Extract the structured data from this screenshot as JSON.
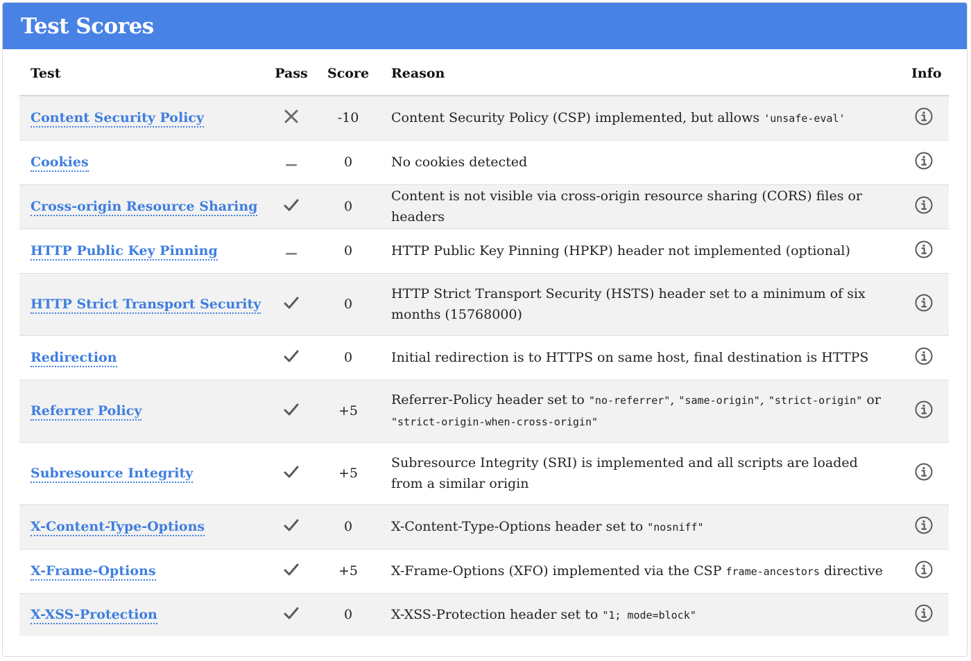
{
  "header": {
    "title": "Test Scores"
  },
  "columns": {
    "test": "Test",
    "pass": "Pass",
    "score": "Score",
    "reason": "Reason",
    "info": "Info"
  },
  "rows": [
    {
      "test": "Content Security Policy",
      "pass": "fail",
      "score": "-10",
      "reason": [
        {
          "t": "Content Security Policy (CSP) implemented, but allows "
        },
        {
          "t": "'unsafe-eval'",
          "code": true
        }
      ]
    },
    {
      "test": "Cookies",
      "pass": "neutral",
      "score": "0",
      "reason": [
        {
          "t": "No cookies detected"
        }
      ]
    },
    {
      "test": "Cross-origin Resource Sharing",
      "pass": "pass",
      "score": "0",
      "reason": [
        {
          "t": "Content is not visible via cross-origin resource sharing (CORS) files or headers"
        }
      ]
    },
    {
      "test": "HTTP Public Key Pinning",
      "pass": "neutral",
      "score": "0",
      "reason": [
        {
          "t": "HTTP Public Key Pinning (HPKP) header not implemented (optional)"
        }
      ]
    },
    {
      "test": "HTTP Strict Transport Security",
      "pass": "pass",
      "score": "0",
      "reason": [
        {
          "t": "HTTP Strict Transport Security (HSTS) header set to a minimum of six months (15768000)"
        }
      ]
    },
    {
      "test": "Redirection",
      "pass": "pass",
      "score": "0",
      "reason": [
        {
          "t": "Initial redirection is to HTTPS on same host, final destination is HTTPS"
        }
      ]
    },
    {
      "test": "Referrer Policy",
      "pass": "pass",
      "score": "+5",
      "reason": [
        {
          "t": "Referrer-Policy header set to "
        },
        {
          "t": "\"no-referrer\"",
          "code": true
        },
        {
          "t": ", "
        },
        {
          "t": "\"same-origin\"",
          "code": true
        },
        {
          "t": ", "
        },
        {
          "t": "\"strict-origin\"",
          "code": true
        },
        {
          "t": " or "
        },
        {
          "t": "\"strict-origin-when-cross-origin\"",
          "code": true
        }
      ]
    },
    {
      "test": "Subresource Integrity",
      "pass": "pass",
      "score": "+5",
      "reason": [
        {
          "t": "Subresource Integrity (SRI) is implemented and all scripts are loaded from a similar origin"
        }
      ]
    },
    {
      "test": "X-Content-Type-Options",
      "pass": "pass",
      "score": "0",
      "reason": [
        {
          "t": "X-Content-Type-Options header set to "
        },
        {
          "t": "\"nosniff\"",
          "code": true
        }
      ]
    },
    {
      "test": "X-Frame-Options",
      "pass": "pass",
      "score": "+5",
      "reason": [
        {
          "t": "X-Frame-Options (XFO) implemented via the CSP "
        },
        {
          "t": "frame-ancestors",
          "code": true
        },
        {
          "t": " directive"
        }
      ]
    },
    {
      "test": "X-XSS-Protection",
      "pass": "pass",
      "score": "0",
      "reason": [
        {
          "t": "X-XSS-Protection header set to "
        },
        {
          "t": "\"1; mode=block\"",
          "code": true
        }
      ]
    }
  ],
  "icons": {
    "pass": "check-icon",
    "fail": "x-icon",
    "neutral": "dash-icon",
    "info": "info-circle-icon"
  },
  "colors": {
    "header_bg": "#4882e5",
    "link": "#3f7ee0",
    "row_alt": "#f2f2f2",
    "icon": "#555555"
  }
}
